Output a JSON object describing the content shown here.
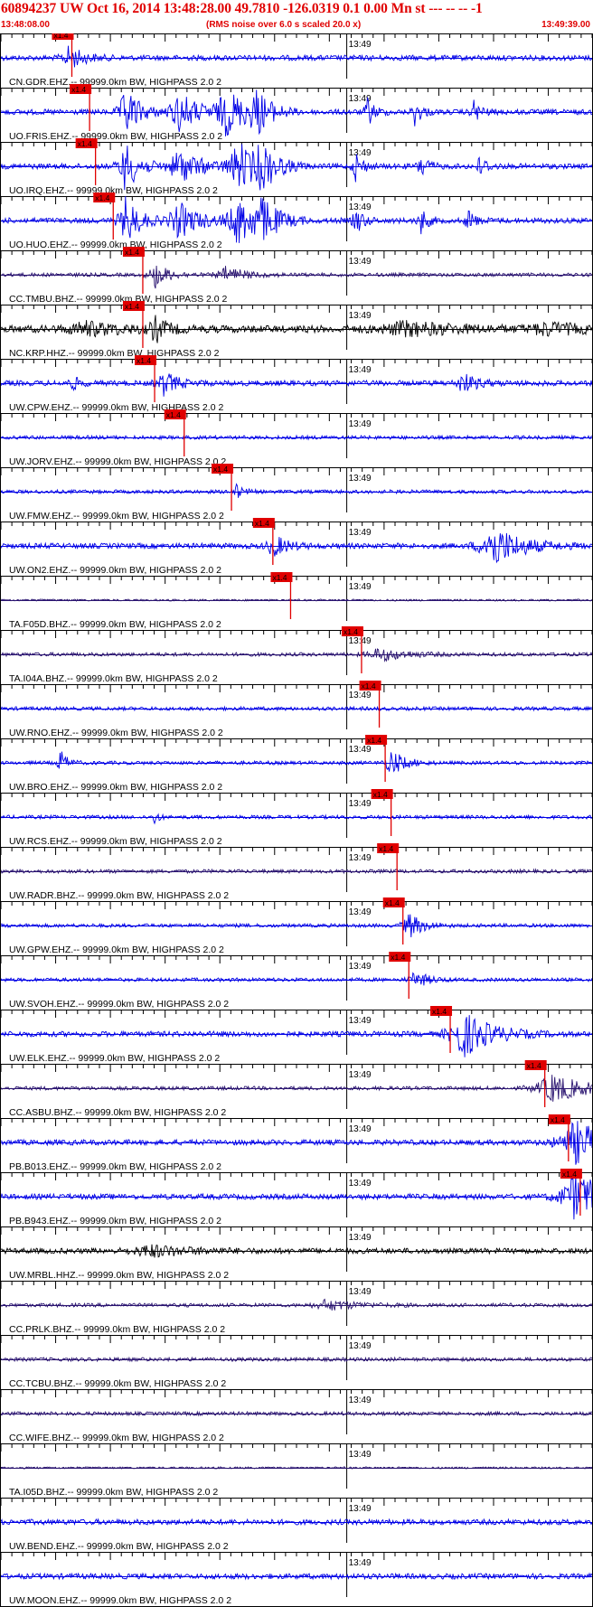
{
  "header": {
    "title": "60894237 UW Oct 16, 2014 13:48:28.00   49.7810 -126.0319  0.1 0.00 Mn st --- -- --  -1",
    "start_time": "13:48:08.00",
    "note": "(RMS noise over 6.0 s scaled 20.0 x)",
    "end_time": "13:49:39.00"
  },
  "colors": {
    "title": "#e00000",
    "pick": "#e00000",
    "blue": "#0000e6",
    "purple": "#2a1470",
    "black": "#000000"
  },
  "chart_data": {
    "type": "line",
    "title": "60894237 UW Oct 16, 2014 13:48:28.00   49.7810 -126.0319  0.1 0.00 Mn st --- -- --  -1",
    "x_range": [
      "13:48:08.00",
      "13:49:39.00"
    ],
    "minute_label": "13:49",
    "pick_label": "x1.4",
    "grid": false,
    "series": [
      {
        "name": "CN.GDR.EHZ.--",
        "label": "CN.GDR.EHZ.-- 99999.0km BW, HIGHPASS  2.0  2",
        "color": "blue",
        "amp": 3,
        "pick": 0.12,
        "events": [
          [
            0.115,
            13,
            0.02
          ]
        ]
      },
      {
        "name": "UO.FRIS.EHZ.--",
        "label": "UO.FRIS.EHZ.-- 99999.0km BW, HIGHPASS  2.0  2",
        "color": "blue",
        "amp": 3,
        "pick": 0.15,
        "events": [
          [
            0.21,
            28,
            0.02
          ],
          [
            0.3,
            22,
            0.03
          ],
          [
            0.38,
            26,
            0.03
          ],
          [
            0.43,
            24,
            0.02
          ],
          [
            0.62,
            16,
            0.01
          ],
          [
            0.7,
            14,
            0.01
          ],
          [
            0.8,
            12,
            0.01
          ]
        ]
      },
      {
        "name": "UO.IRQ.EHZ.--",
        "label": "UO.IRQ.EHZ.-- 99999.0km BW, HIGHPASS  2.0  2",
        "color": "blue",
        "amp": 3,
        "pick": 0.16,
        "events": [
          [
            0.21,
            28,
            0.02
          ],
          [
            0.3,
            20,
            0.03
          ],
          [
            0.4,
            27,
            0.03
          ],
          [
            0.44,
            24,
            0.02
          ],
          [
            0.6,
            16,
            0.01
          ],
          [
            0.71,
            14,
            0.01
          ],
          [
            0.81,
            12,
            0.01
          ]
        ]
      },
      {
        "name": "UO.HUO.EHZ.--",
        "label": "UO.HUO.EHZ.-- 99999.0km BW, HIGHPASS  2.0  2",
        "color": "blue",
        "amp": 3,
        "pick": 0.19,
        "events": [
          [
            0.21,
            28,
            0.02
          ],
          [
            0.3,
            20,
            0.03
          ],
          [
            0.4,
            27,
            0.03
          ],
          [
            0.44,
            24,
            0.02
          ],
          [
            0.6,
            16,
            0.01
          ],
          [
            0.71,
            14,
            0.01
          ],
          [
            0.79,
            12,
            0.01
          ]
        ]
      },
      {
        "name": "CC.TMBU.BHZ.--",
        "label": "CC.TMBU.BHZ.-- 99999.0km BW, HIGHPASS  2.0  2",
        "color": "purple",
        "amp": 2,
        "pick": 0.24,
        "events": [
          [
            0.26,
            14,
            0.02
          ],
          [
            0.38,
            8,
            0.03
          ]
        ]
      },
      {
        "name": "NC.KRP.HHZ.--",
        "label": "NC.KRP.HHZ.-- 99999.0km BW, HIGHPASS  2.0  2",
        "color": "black",
        "amp": 4,
        "pick": 0.24,
        "events": [
          [
            0.26,
            14,
            0.015
          ],
          [
            0.14,
            7,
            0.06
          ],
          [
            0.68,
            7,
            0.08
          ],
          [
            0.92,
            6,
            0.05
          ]
        ]
      },
      {
        "name": "UW.CPW.EHZ.--",
        "label": "UW.CPW.EHZ.-- 99999.0km BW, HIGHPASS  2.0  2",
        "color": "blue",
        "amp": 3,
        "pick": 0.26,
        "events": [
          [
            0.275,
            13,
            0.02
          ],
          [
            0.78,
            11,
            0.02
          ],
          [
            0.12,
            8,
            0.01
          ]
        ]
      },
      {
        "name": "UW.JORV.EHZ.--",
        "label": "UW.JORV.EHZ.-- 99999.0km BW, HIGHPASS  2.0  2",
        "color": "blue",
        "amp": 2,
        "pick": 0.31,
        "events": []
      },
      {
        "name": "UW.FMW.EHZ.--",
        "label": "UW.FMW.EHZ.-- 99999.0km BW, HIGHPASS  2.0  2",
        "color": "blue",
        "amp": 2,
        "pick": 0.39,
        "events": [
          [
            0.395,
            10,
            0.01
          ]
        ]
      },
      {
        "name": "UW.ON2.EHZ.--",
        "label": "UW.ON2.EHZ.-- 99999.0km BW, HIGHPASS  2.0  2",
        "color": "blue",
        "amp": 3,
        "pick": 0.46,
        "events": [
          [
            0.46,
            12,
            0.02
          ],
          [
            0.83,
            24,
            0.04
          ]
        ]
      },
      {
        "name": "TA.F05D.BHZ.--",
        "label": "TA.F05D.BHZ.-- 99999.0km BW, HIGHPASS  2.0  2",
        "color": "purple",
        "amp": 1,
        "pick": 0.49,
        "events": []
      },
      {
        "name": "TA.I04A.BHZ.--",
        "label": "TA.I04A.BHZ.-- 99999.0km BW, HIGHPASS  2.0  2",
        "color": "purple",
        "amp": 2,
        "pick": 0.61,
        "events": [
          [
            0.64,
            7,
            0.04
          ]
        ]
      },
      {
        "name": "UW.RNO.EHZ.--",
        "label": "UW.RNO.EHZ.-- 99999.0km BW, HIGHPASS  2.0  2",
        "color": "blue",
        "amp": 2,
        "pick": 0.64,
        "events": []
      },
      {
        "name": "UW.BRO.EHZ.--",
        "label": "UW.BRO.EHZ.-- 99999.0km BW, HIGHPASS  2.0  2",
        "color": "blue",
        "amp": 2,
        "pick": 0.65,
        "events": [
          [
            0.66,
            14,
            0.02
          ],
          [
            0.1,
            14,
            0.01
          ]
        ]
      },
      {
        "name": "UW.RCS.EHZ.--",
        "label": "UW.RCS.EHZ.-- 99999.0km BW, HIGHPASS  2.0  2",
        "color": "blue",
        "amp": 2,
        "pick": 0.66,
        "events": [
          [
            0.26,
            10,
            0.005
          ]
        ]
      },
      {
        "name": "UW.RADR.BHZ.--",
        "label": "UW.RADR.BHZ.-- 99999.0km BW, HIGHPASS  2.0  2",
        "color": "purple",
        "amp": 2,
        "pick": 0.67,
        "events": []
      },
      {
        "name": "UW.GPW.EHZ.--",
        "label": "UW.GPW.EHZ.-- 99999.0km BW, HIGHPASS  2.0  2",
        "color": "blue",
        "amp": 2,
        "pick": 0.68,
        "events": [
          [
            0.69,
            14,
            0.02
          ]
        ]
      },
      {
        "name": "UW.SVOH.EHZ.--",
        "label": "UW.SVOH.EHZ.-- 99999.0km BW, HIGHPASS  2.0  2",
        "color": "blue",
        "amp": 2,
        "pick": 0.69,
        "events": [
          [
            0.7,
            9,
            0.02
          ]
        ]
      },
      {
        "name": "UW.ELK.EHZ.--",
        "label": "UW.ELK.EHZ.-- 99999.0km BW, HIGHPASS  2.0  2",
        "color": "blue",
        "amp": 3,
        "pick": 0.76,
        "events": [
          [
            0.78,
            26,
            0.04
          ]
        ]
      },
      {
        "name": "CC.ASBU.BHZ.--",
        "label": "CC.ASBU.BHZ.-- 99999.0km BW, HIGHPASS  2.0  2",
        "color": "purple",
        "amp": 2,
        "pick": 0.92,
        "events": [
          [
            0.93,
            16,
            0.05
          ]
        ]
      },
      {
        "name": "PB.B013.EHZ.--",
        "label": "PB.B013.EHZ.-- 99999.0km BW, HIGHPASS  2.0  2",
        "color": "blue",
        "amp": 3,
        "pick": 0.96,
        "events": [
          [
            0.97,
            24,
            0.05
          ]
        ]
      },
      {
        "name": "PB.B943.EHZ.--",
        "label": "PB.B943.EHZ.-- 99999.0km BW, HIGHPASS  2.0  2",
        "color": "blue",
        "amp": 3,
        "pick": 0.98,
        "events": [
          [
            0.97,
            26,
            0.05
          ]
        ]
      },
      {
        "name": "UW.MRBL.HHZ.--",
        "label": "UW.MRBL.HHZ.-- 99999.0km BW, HIGHPASS  2.0  2",
        "color": "black",
        "amp": 3,
        "pick": null,
        "events": [
          [
            0.25,
            6,
            0.06
          ]
        ]
      },
      {
        "name": "CC.PRLK.BHZ.--",
        "label": "CC.PRLK.BHZ.-- 99999.0km BW, HIGHPASS  2.0  2",
        "color": "purple",
        "amp": 2,
        "pick": null,
        "events": [
          [
            0.55,
            6,
            0.04
          ]
        ]
      },
      {
        "name": "CC.TCBU.BHZ.--",
        "label": "CC.TCBU.BHZ.-- 99999.0km BW, HIGHPASS  2.0  2",
        "color": "purple",
        "amp": 2,
        "pick": null,
        "events": []
      },
      {
        "name": "CC.WIFE.BHZ.--",
        "label": "CC.WIFE.BHZ.-- 99999.0km BW, HIGHPASS  2.0  2",
        "color": "purple",
        "amp": 2,
        "pick": null,
        "events": []
      },
      {
        "name": "TA.I05D.BHZ.--",
        "label": "TA.I05D.BHZ.-- 99999.0km BW, HIGHPASS  2.0  2",
        "color": "purple",
        "amp": 1,
        "pick": null,
        "events": []
      },
      {
        "name": "UW.BEND.EHZ.--",
        "label": "UW.BEND.EHZ.-- 99999.0km BW, HIGHPASS  2.0  2",
        "color": "blue",
        "amp": 3,
        "pick": null,
        "events": []
      },
      {
        "name": "UW.MOON.EHZ.--",
        "label": "UW.MOON.EHZ.-- 99999.0km BW, HIGHPASS  2.0  2",
        "color": "blue",
        "amp": 3,
        "pick": null,
        "events": []
      }
    ]
  }
}
